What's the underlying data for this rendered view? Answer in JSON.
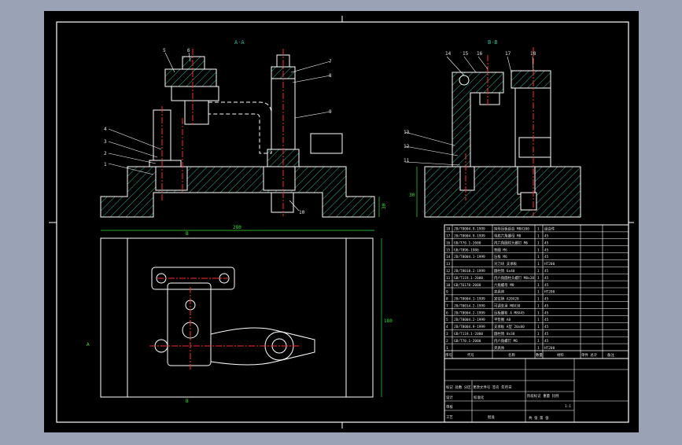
{
  "colors": {
    "frame_bg": "#9aa3b6",
    "canvas": "#000000",
    "line": "#ffffff",
    "hatch": "#2fb39a",
    "center": "#ff2a2a",
    "dim": "#35e035",
    "text": "#e8e8e8"
  },
  "views": {
    "section_aa": "A-A",
    "section_bb": "B-B",
    "label_a": "A",
    "label_b": "B"
  },
  "dimensions": {
    "width_overall": "280",
    "height_plan": "180",
    "height_left": "30",
    "height_right": "30"
  },
  "callouts_left": [
    "1",
    "2",
    "3",
    "4",
    "5",
    "6",
    "7",
    "8",
    "9",
    "10"
  ],
  "callouts_right": [
    "11",
    "12",
    "13",
    "14",
    "15",
    "16",
    "17",
    "18"
  ],
  "bom": {
    "headers": {
      "no": "序号",
      "code": "代号",
      "name": "名称",
      "qty": "数量",
      "material": "材料",
      "weight": "单件 总计",
      "remark": "备注"
    },
    "rows": [
      {
        "no": "18",
        "code": "JB/T8004.9-1999",
        "name": "钩形压板组合 M8X100",
        "qty": "1",
        "mat": "组合件"
      },
      {
        "no": "17",
        "code": "JB/T8004.9-1999",
        "name": "带肩六角螺母 M8",
        "qty": "1",
        "mat": "45"
      },
      {
        "no": "16",
        "code": "GB/T70.1-2000",
        "name": "内六角圆柱头螺钉 M6",
        "qty": "1",
        "mat": "45"
      },
      {
        "no": "15",
        "code": "GB/T896-1986",
        "name": "垫圈 M6",
        "qty": "1",
        "mat": "45"
      },
      {
        "no": "14",
        "code": "JB/T8004.1-1999",
        "name": "压板 M6",
        "qty": "1",
        "mat": "45"
      },
      {
        "no": "13",
        "code": "",
        "name": "对刀块 支承板",
        "qty": "1",
        "mat": "HT200"
      },
      {
        "no": "12",
        "code": "JB/T8018.2-1999",
        "name": "圆柱销 6x40",
        "qty": "1",
        "mat": "45"
      },
      {
        "no": "11",
        "code": "GB/T119.1-2000",
        "name": "内六角圆柱头螺钉 M8x20",
        "qty": "1",
        "mat": "45"
      },
      {
        "no": "10",
        "code": "GB/T6170-2000",
        "name": "六角螺母 M8",
        "qty": "1",
        "mat": "45"
      },
      {
        "no": "9",
        "code": "",
        "name": "夹具体",
        "qty": "1",
        "mat": "HT200"
      },
      {
        "no": "8",
        "code": "JB/T8004.1-1999",
        "name": "定位销 A20X20",
        "qty": "1",
        "mat": "45"
      },
      {
        "no": "7",
        "code": "JB/T8014.2-1999",
        "name": "可调支承 M8X30",
        "qty": "1",
        "mat": "45"
      },
      {
        "no": "6",
        "code": "JB/T8004.2-1999",
        "name": "压板螺栓 A M8X45",
        "qty": "1",
        "mat": "45"
      },
      {
        "no": "5",
        "code": "JB/T8004.2-1999",
        "name": "平垫圈 A8",
        "qty": "1",
        "mat": "45"
      },
      {
        "no": "4",
        "code": "JB/T8004.9-1999",
        "name": "支承板 A型 20x80",
        "qty": "1",
        "mat": "45"
      },
      {
        "no": "3",
        "code": "GB/T119.1-2000",
        "name": "圆柱销 8x30",
        "qty": "1",
        "mat": "45"
      },
      {
        "no": "2",
        "code": "GB/T70.1-2000",
        "name": "内六角螺钉 M6",
        "qty": "1",
        "mat": "45"
      },
      {
        "no": "1",
        "code": "",
        "name": "夹具体",
        "qty": "1",
        "mat": "HT200"
      }
    ]
  },
  "title_block": {
    "design": "设计",
    "check": "审核",
    "craft": "工艺",
    "marking": "标记 处数 分区 更改文件号 签名 年月日",
    "standard": "标准化",
    "approve": "批准",
    "stage": "阶段标记 重量 比例",
    "scale": "1:1",
    "sheet": "共 张 第 张"
  }
}
